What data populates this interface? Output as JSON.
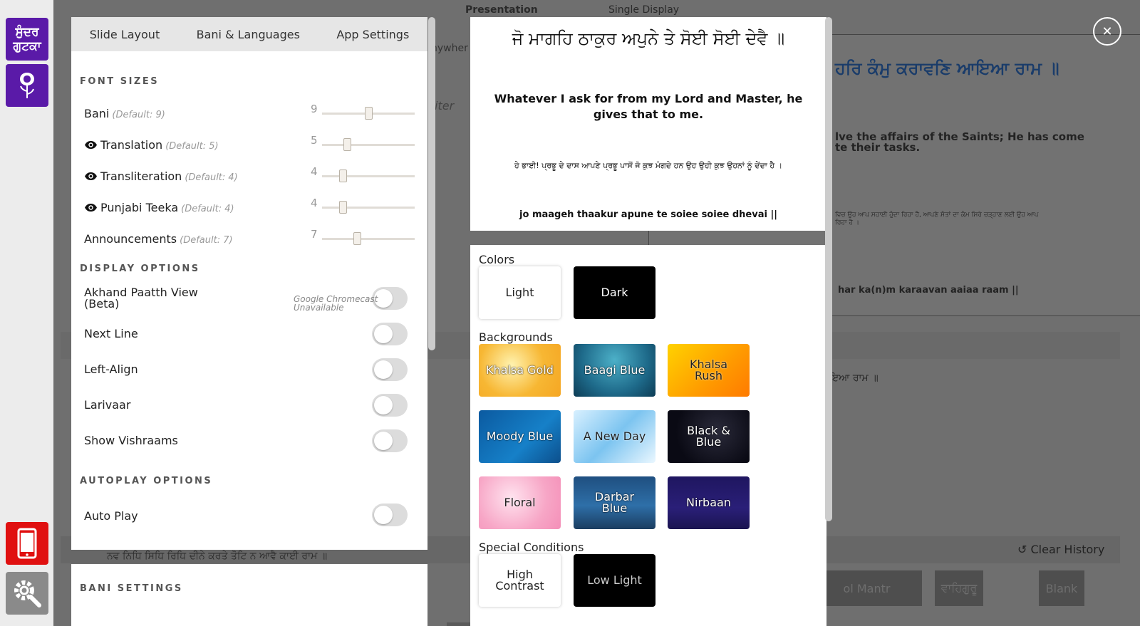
{
  "rail": {
    "gutka_logo": "ਸੁੰਦਰ ਗੁਟਕਾ"
  },
  "background_app": {
    "tabs": [
      "Presentation",
      "Single Display"
    ],
    "display_gurmukhi": "ਹਰਿ ਕੰਮੁ ਕਰਾਵਣਿ ਆਇਆ ਰਾਮ ॥",
    "display_translation": "lve the affairs of the Saints; He has come\nte their tasks.",
    "display_teeka": "ਵਿਚ ਉਹ ਆਪ ਸਹਾਈ ਹੁੰਦਾ ਰਿਹਾ ਹੈ, ਆਪਣੇ ਸੰਤਾਂ ਦਾ ਕੰਮ ਸਿਰੇ ਚੜ੍ਹਾਣ ਲਈ ਉਹ ਆਪ\nਰਿਹਾ ਹੈ ।",
    "display_translit": "har ka(n)m karaavan aaiaa raam ||",
    "history_line": "ਇਆ ਰਾਮ ॥",
    "clear_history": "Clear History",
    "gurmukhi_line": "ਨਵ ਨਿਧਿ ਸਿਧਿ ਰਿਧਿ ਦੀਨੇ ਕਰਤੇ ਤੋਟਿ ਨ ਆਵੈ ਕਾਈ ਰਾਮ ॥",
    "partial_labels": {
      "anywhere": "nywher",
      "filter": "iter"
    },
    "quick_buttons": [
      "ol Mantr",
      "ਵਾਹਿਗੁਰੂ",
      "Blank"
    ]
  },
  "settings": {
    "tabs": [
      "Slide Layout",
      "Bani & Languages",
      "App Settings"
    ],
    "font_sizes_title": "FONT SIZES",
    "font_sizes": [
      {
        "label": "Bani",
        "default": "(Default: 9)",
        "value": "9",
        "level": 0.5,
        "eye": false
      },
      {
        "label": "Translation",
        "default": "(Default: 5)",
        "value": "5",
        "level": 0.27,
        "eye": true
      },
      {
        "label": "Transliteration",
        "default": "(Default: 4)",
        "value": "4",
        "level": 0.22,
        "eye": true
      },
      {
        "label": "Punjabi Teeka",
        "default": "(Default: 4)",
        "value": "4",
        "level": 0.22,
        "eye": true
      },
      {
        "label": "Announcements",
        "default": "(Default: 7)",
        "value": "7",
        "level": 0.38,
        "eye": false
      }
    ],
    "display_options_title": "DISPLAY OPTIONS",
    "display_options": [
      {
        "label": "Akhand Paatth View\n(Beta)",
        "on": false
      },
      {
        "label": "Next Line",
        "on": false
      },
      {
        "label": "Left-Align",
        "on": false
      },
      {
        "label": "Larivaar",
        "on": false
      },
      {
        "label": "Show Vishraams",
        "on": false
      }
    ],
    "chromecast_note": "Google Chromecast\nUnavailable",
    "autoplay_title": "AUTOPLAY OPTIONS",
    "autoplay": {
      "label": "Auto Play",
      "on": false
    },
    "bani_settings_title": "BANI SETTINGS"
  },
  "preview": {
    "gurmukhi": "ਜੋ ਮਾਗਹਿ ਠਾਕੁਰ ਅਪੁਨੇ ਤੇ ਸੋਈ ਸੋਈ ਦੇਵੈ ॥",
    "translation": "Whatever I ask for from my Lord and Master, he gives that to me.",
    "teeka": "ਹੇ ਭਾਈ! ਪ੍ਰਭੂ ਦੇ ਦਾਸ ਆਪਣੇ ਪ੍ਰਭੂ ਪਾਸੋਂ ਜੋ ਕੁਝ ਮੰਗਦੇ ਹਨ ਉਹ ਉਹੀ ਕੁਝ ਉਹਨਾਂ ਨੂੰ ਦੇਂਦਾ ਹੈ ।",
    "transliteration": "jo maageh thaakur apune te soiee soiee dhevai ||"
  },
  "themes": {
    "colors_title": "Colors",
    "colors": [
      {
        "name": "Light",
        "bg": "#ffffff",
        "fg": "#222222"
      },
      {
        "name": "Dark",
        "bg": "#000000",
        "fg": "#ffffff"
      }
    ],
    "backgrounds_title": "Backgrounds",
    "backgrounds": [
      {
        "name": "Khalsa Gold",
        "style": "outlined"
      },
      {
        "name": "Baagi Blue",
        "style": "outlined"
      },
      {
        "name": "Khalsa\nRush",
        "style": "darkonlight"
      },
      {
        "name": "Moody Blue",
        "style": "outlined"
      },
      {
        "name": "A New Day",
        "style": "darkonlight"
      },
      {
        "name": "Black &\nBlue",
        "style": "outlined"
      },
      {
        "name": "Floral",
        "style": "darkonlight"
      },
      {
        "name": "Darbar\nBlue",
        "style": "outlined"
      },
      {
        "name": "Nirbaan",
        "style": "outlined"
      }
    ],
    "special_title": "Special Conditions",
    "special": [
      {
        "name": "High\nContrast",
        "bg": "#ffffff",
        "fg": "#222222"
      },
      {
        "name": "Low Light",
        "bg": "#000000",
        "fg": "#cccccc"
      }
    ]
  }
}
